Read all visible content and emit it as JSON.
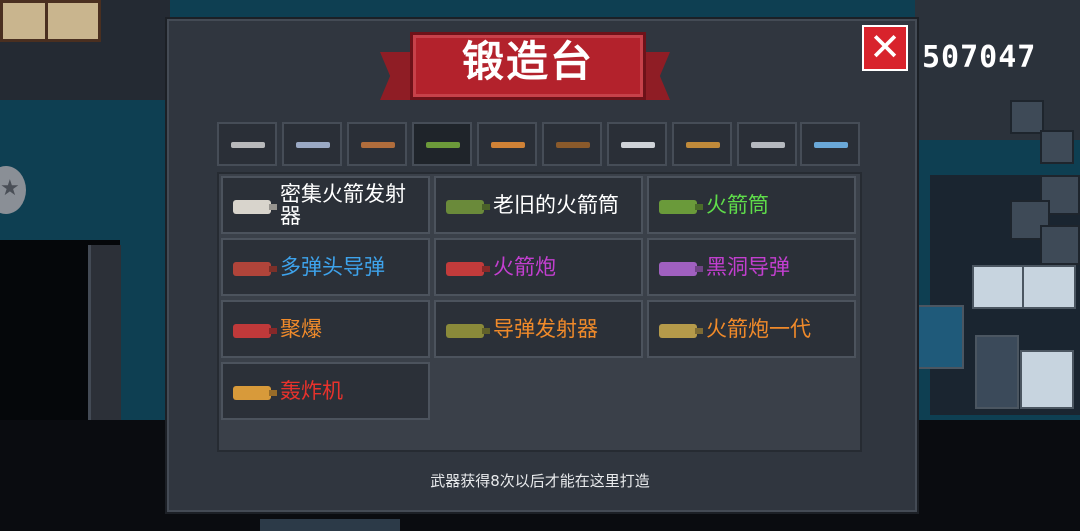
{
  "title": "锻造台",
  "currency": "507047",
  "close_label": "✕",
  "hint": "武器获得8次以后才能在这里打造",
  "tabs": [
    {
      "icon": "pistol-icon",
      "color": "#b8b9bb"
    },
    {
      "icon": "rifle-icon",
      "color": "#9aa9c4"
    },
    {
      "icon": "shotgun-icon",
      "color": "#b06d3c"
    },
    {
      "icon": "rocket-launcher-icon",
      "color": "#6c9a3a"
    },
    {
      "icon": "blaster-icon",
      "color": "#d08236"
    },
    {
      "icon": "bow-icon",
      "color": "#8a5a2b"
    },
    {
      "icon": "sword-icon",
      "color": "#cfd3d8"
    },
    {
      "icon": "staff-icon",
      "color": "#c08a3a"
    },
    {
      "icon": "shuriken-icon",
      "color": "#b5b9bf"
    },
    {
      "icon": "fish-icon",
      "color": "#6aa8d8"
    }
  ],
  "weapons": [
    {
      "name": "密集火箭发射器",
      "color": "#ffffff",
      "icon_color": "#d8d4cc"
    },
    {
      "name": "老旧的火箭筒",
      "color": "#ffffff",
      "icon_color": "#6a8a3a"
    },
    {
      "name": "火箭筒",
      "color": "#5fdc4a",
      "icon_color": "#6a9a3a"
    },
    {
      "name": "多弹头导弹",
      "color": "#3ea3ec",
      "icon_color": "#b0443a"
    },
    {
      "name": "火箭炮",
      "color": "#c23fcf",
      "icon_color": "#c23b3b"
    },
    {
      "name": "黑洞导弹",
      "color": "#c23fcf",
      "icon_color": "#a060c0"
    },
    {
      "name": "聚爆",
      "color": "#f08a2a",
      "icon_color": "#c0393a"
    },
    {
      "name": "导弹发射器",
      "color": "#f08a2a",
      "icon_color": "#8a8a3a"
    },
    {
      "name": "火箭炮一代",
      "color": "#f08a2a",
      "icon_color": "#b59a4a"
    },
    {
      "name": "轰炸机",
      "color": "#e8322c",
      "icon_color": "#d89a3a"
    }
  ]
}
